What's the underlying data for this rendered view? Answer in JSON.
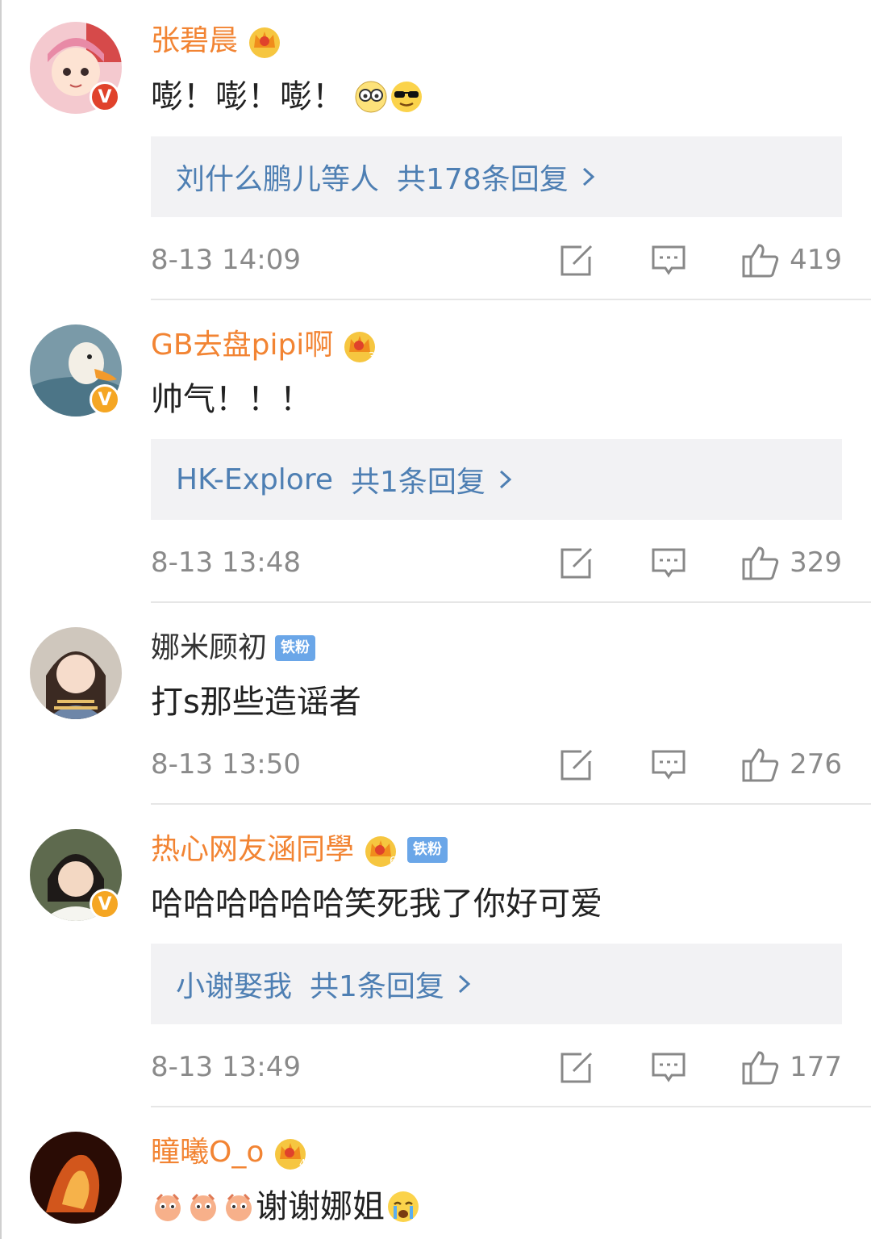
{
  "comments": [
    {
      "name": "张碧晨",
      "name_style": "vip",
      "vip_level": "",
      "fan_badge": "",
      "badge_color": "#e0422b",
      "text": "嘭！嘭！嘭！",
      "emojis": [
        "nerd-emoji",
        "sunglasses-emoji"
      ],
      "replies": {
        "users": "刘什么鹏儿等人",
        "summary": "共178条回复"
      },
      "time": "8-13 14:09",
      "likes": "419"
    },
    {
      "name": "GB去盘pipi啊",
      "name_style": "vip",
      "vip_level": "3",
      "fan_badge": "",
      "badge_color": "#f5a623",
      "text": "帅气！！！",
      "emojis": [],
      "replies": {
        "users": "HK-Explore",
        "summary": "共1条回复"
      },
      "time": "8-13 13:48",
      "likes": "329"
    },
    {
      "name": "娜米顾初",
      "name_style": "plain",
      "vip_level": "",
      "fan_badge": "铁粉",
      "badge_color": "",
      "text": "打s那些造谣者",
      "emojis": [],
      "replies": null,
      "time": "8-13 13:50",
      "likes": "276"
    },
    {
      "name": "热心网友涵同學",
      "name_style": "vip",
      "vip_level": "6",
      "fan_badge": "铁粉",
      "badge_color": "#f5a623",
      "text": "哈哈哈哈哈哈笑死我了你好可爱",
      "emojis": [],
      "replies": {
        "users": "小谢娶我",
        "summary": "共1条回复"
      },
      "time": "8-13 13:49",
      "likes": "177"
    },
    {
      "name": "瞳曦O_o",
      "name_style": "vip",
      "vip_level": "4",
      "fan_badge": "",
      "badge_color": "",
      "text": "谢谢娜姐",
      "emojis_before": [
        "clap-emoji",
        "clap-emoji",
        "clap-emoji"
      ],
      "emojis": [
        "crying-emoji"
      ],
      "replies": null,
      "time": "",
      "likes": ""
    }
  ],
  "colors": {
    "vip_name": "#f28433",
    "reply_link": "#4e7fb3",
    "meta": "#8a8a8a",
    "fan_badge": "#6aa6e8"
  }
}
